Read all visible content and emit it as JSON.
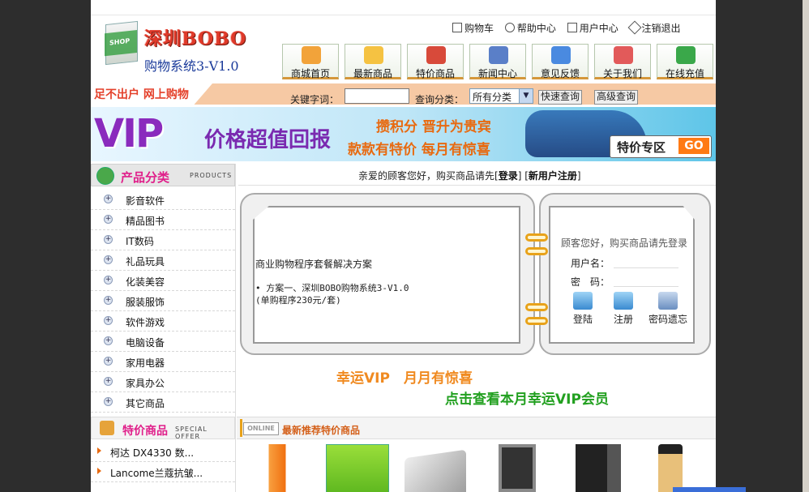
{
  "header": {
    "logo_name": "深圳BOBO",
    "logo_version": "购物系统3-V1.0",
    "bag_text": "SHOP",
    "top_links": [
      "购物车",
      "帮助中心",
      "用户中心",
      "注销退出"
    ]
  },
  "nav": [
    {
      "label": "商城首页",
      "icon": "home-icon",
      "color": "#f2a33a"
    },
    {
      "label": "最新商品",
      "icon": "new-products-icon",
      "color": "#f5c242"
    },
    {
      "label": "特价商品",
      "icon": "bar-chart-icon",
      "color": "#d84a3a"
    },
    {
      "label": "新闻中心",
      "icon": "news-icon",
      "color": "#5a7fc8"
    },
    {
      "label": "意见反馈",
      "icon": "feedback-icon",
      "color": "#4a8ae0"
    },
    {
      "label": "关于我们",
      "icon": "people-icon",
      "color": "#e25a5a"
    },
    {
      "label": "在线充值",
      "icon": "recharge-icon",
      "color": "#3aa84a"
    }
  ],
  "search": {
    "slogan": "足不出户  网上购物",
    "keyword_label": "关键字词：",
    "keyword_value": "",
    "category_label": "查询分类：",
    "category_selected": "所有分类",
    "quick_search": "快速查询",
    "advanced_search": "高级查询"
  },
  "banner": {
    "vip": "VIP",
    "tagline": "价格超值回报",
    "line1": "攒积分  晋升为贵宾",
    "line2": "款款有特价  每月有惊喜",
    "special_label": "特价专区",
    "go": "GO"
  },
  "categories": {
    "title": "产品分类",
    "subtitle": "PRODUCTS",
    "items": [
      "影音软件",
      "精品图书",
      "IT数码",
      "礼品玩具",
      "化装美容",
      "服装服饰",
      "软件游戏",
      "电脑设备",
      "家用电器",
      "家具办公",
      "其它商品"
    ]
  },
  "specials": {
    "title": "特价商品",
    "subtitle": "SPECIAL OFFER",
    "items": [
      "柯达 DX4330 数...",
      "Lancome兰蔻抗皱..."
    ]
  },
  "welcome": {
    "prefix": "亲爱的顾客您好，购买商品请先[",
    "login": "登录",
    "middle": "] [",
    "register": "新用户注册",
    "suffix": "]"
  },
  "main_panel": {
    "title": "商业购物程序套餐解决方案",
    "line1": "• 方案一、深圳BOBO购物系统3-V1.0",
    "line2": "(单购程序230元/套)"
  },
  "login_panel": {
    "hint": "顾客您好，购买商品请先登录",
    "username_label": "用户名：",
    "password_label": "密　码：",
    "buttons": [
      "登陆",
      "注册",
      "密码遗忘"
    ]
  },
  "promo": {
    "line1": "幸运VIP　月月有惊喜",
    "line2": "点击查看本月幸运VIP会员"
  },
  "recommend": {
    "badge": "ONLINE",
    "title": "最新推荐特价商品"
  }
}
